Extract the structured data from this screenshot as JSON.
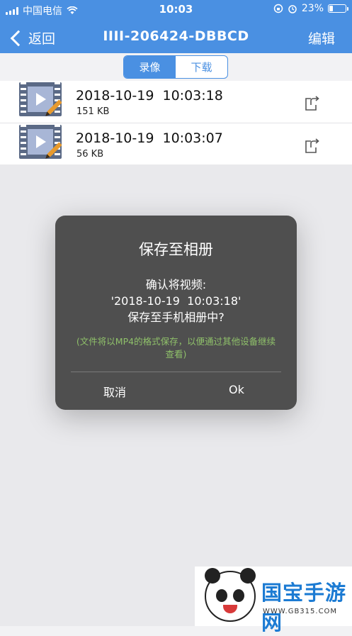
{
  "status": {
    "carrier": "中国电信",
    "time": "10:03",
    "battery": "23%",
    "battery_level": 0.23
  },
  "nav": {
    "back_label": "返回",
    "title": "IIII-206424-DBBCD",
    "edit_label": "编辑"
  },
  "tabs": [
    {
      "label": "录像",
      "active": true
    },
    {
      "label": "下载",
      "active": false
    }
  ],
  "recordings": [
    {
      "title": "2018-10-19  10:03:18",
      "size": "151 KB"
    },
    {
      "title": "2018-10-19  10:03:07",
      "size": "56 KB"
    }
  ],
  "dialog": {
    "title": "保存至相册",
    "message_lines": [
      "确认将视频:",
      "'2018-10-19  10:03:18'",
      "保存至手机相册中?"
    ],
    "note": "(文件将以MP4的格式保存，以便通过其他设备继续查看)",
    "cancel_label": "取消",
    "ok_label": "Ok"
  },
  "watermark": {
    "brand": "国宝手游网",
    "url": "WWW.GB315.COM"
  },
  "colors": {
    "accent": "#4a90e2",
    "dialog_bg": "#4f4f4f",
    "note_green": "#8fc06a"
  }
}
